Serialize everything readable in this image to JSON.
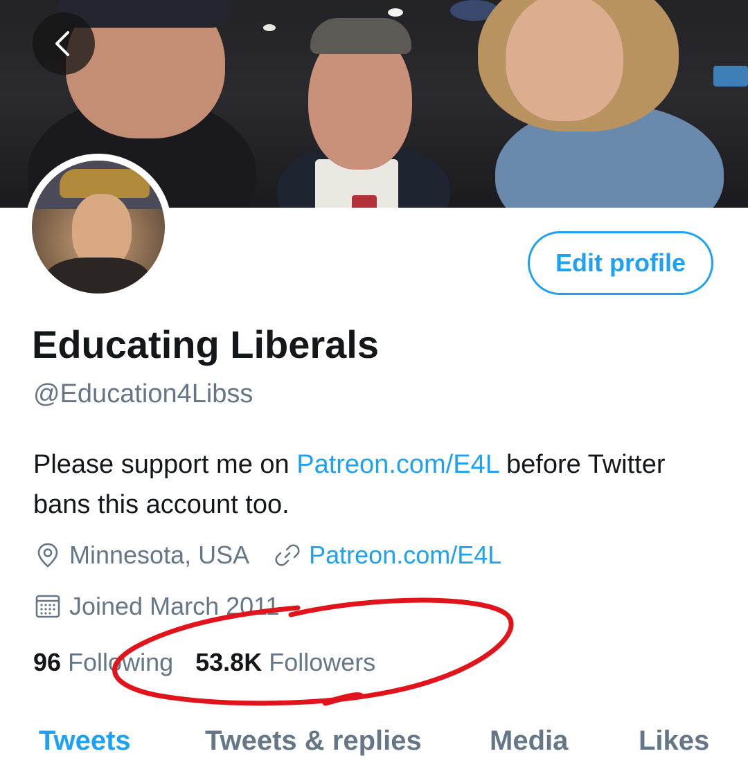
{
  "profile": {
    "display_name": "Educating Liberals",
    "handle": "@Education4Libss",
    "bio_prefix": "Please support me on ",
    "bio_link": "Patreon.com/E4L",
    "bio_suffix": " before Twitter bans this account too.",
    "location": "Minnesota, USA",
    "website": "Patreon.com/E4L",
    "joined": "Joined March 2011"
  },
  "stats": {
    "following_count": "96",
    "following_label": "Following",
    "followers_count": "53.8K",
    "followers_label": "Followers"
  },
  "actions": {
    "edit_profile_label": "Edit profile"
  },
  "tabs": [
    {
      "label": "Tweets",
      "active": true
    },
    {
      "label": "Tweets & replies",
      "active": false
    },
    {
      "label": "Media",
      "active": false
    },
    {
      "label": "Likes",
      "active": false
    }
  ],
  "icons": {
    "back": "chevron-left-icon",
    "location": "location-pin-icon",
    "link": "link-icon",
    "calendar": "calendar-icon"
  },
  "colors": {
    "accent": "#1da1f2",
    "text": "#14171a",
    "muted": "#657786",
    "annotation": "#e0141a"
  }
}
